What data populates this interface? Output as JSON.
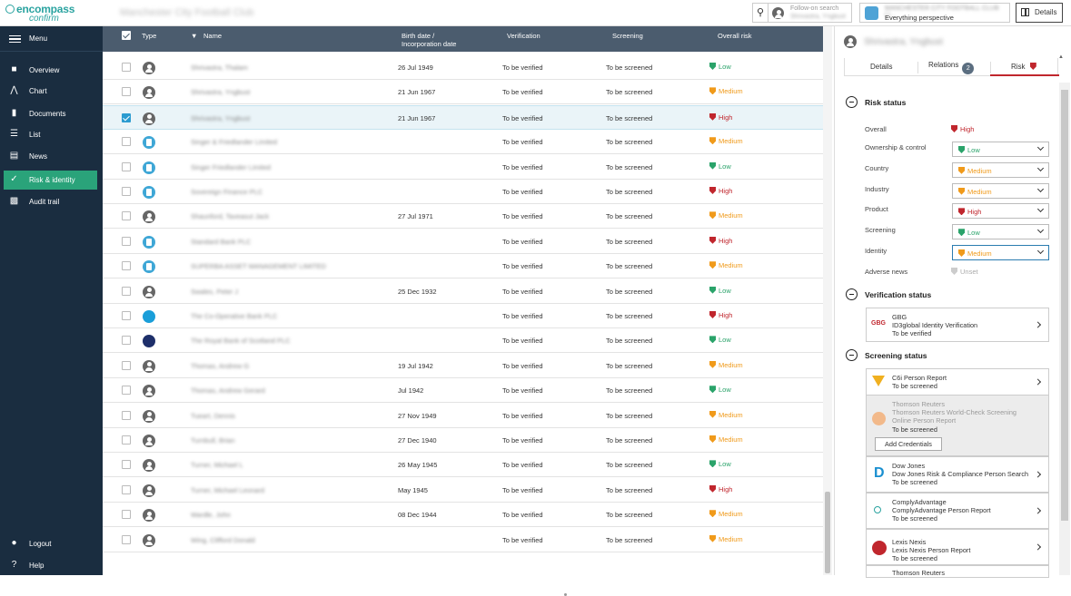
{
  "header": {
    "logo_line1": "encompass",
    "logo_line2": "confirm",
    "case_title": "Manchester City Football Club",
    "follow_label": "Follow-on search",
    "follow_name": "Shrivastra, Yngbust",
    "perspective_name": "MANCHESTER CITY FOOTBALL CLUB LI...",
    "perspective_sub": "Everything perspective",
    "details_label": "Details"
  },
  "sidebar": {
    "menu_label": "Menu",
    "items": [
      {
        "label": "Overview",
        "icon": "folder-icon"
      },
      {
        "label": "Chart",
        "icon": "chart-icon"
      },
      {
        "label": "Documents",
        "icon": "documents-icon"
      },
      {
        "label": "List",
        "icon": "list-icon"
      },
      {
        "label": "News",
        "icon": "news-icon"
      },
      {
        "label": "Risk & identity",
        "icon": "risk-check-icon",
        "active": true
      },
      {
        "label": "Audit trail",
        "icon": "audit-icon"
      }
    ],
    "logout_label": "Logout",
    "help_label": "Help"
  },
  "table": {
    "headers": {
      "type": "Type",
      "name": "Name",
      "birth": "Birth date / Incorporation date",
      "verification": "Verification",
      "screening": "Screening",
      "risk": "Overall risk"
    },
    "rows": [
      {
        "type": "person",
        "name": "Shrivastra, Thalam",
        "birth": "26 Jul 1949",
        "verification": "To be verified",
        "screening": "To be screened",
        "risk": "Low",
        "level": "low"
      },
      {
        "type": "person",
        "name": "Shrivastra, Yngbust",
        "birth": "21 Jun 1967",
        "verification": "To be verified",
        "screening": "To be screened",
        "risk": "Medium",
        "level": "medium"
      },
      {
        "type": "person",
        "name": "Shrivastra, Yngbust",
        "birth": "21 Jun 1967",
        "verification": "To be verified",
        "screening": "To be screened",
        "risk": "High",
        "level": "high",
        "selected": true
      },
      {
        "type": "org",
        "name": "Singer & Friedlander Limited",
        "birth": "",
        "verification": "To be verified",
        "screening": "To be screened",
        "risk": "Medium",
        "level": "medium"
      },
      {
        "type": "org",
        "name": "Singer Friedlander Limited",
        "birth": "",
        "verification": "To be verified",
        "screening": "To be screened",
        "risk": "Low",
        "level": "low"
      },
      {
        "type": "org",
        "name": "Sovereign Finance PLC",
        "birth": "",
        "verification": "To be verified",
        "screening": "To be screened",
        "risk": "High",
        "level": "high"
      },
      {
        "type": "person",
        "name": "Shaunford, Taveasut Jack",
        "birth": "27 Jul 1971",
        "verification": "To be verified",
        "screening": "To be screened",
        "risk": "Medium",
        "level": "medium"
      },
      {
        "type": "org",
        "name": "Standard Bank PLC",
        "birth": "",
        "verification": "To be verified",
        "screening": "To be screened",
        "risk": "High",
        "level": "high"
      },
      {
        "type": "org",
        "name": "SUPERBA ASSET MANAGEMENT LIMITED",
        "birth": "",
        "verification": "To be verified",
        "screening": "To be screened",
        "risk": "Medium",
        "level": "medium"
      },
      {
        "type": "person",
        "name": "Swales, Peter J",
        "birth": "25 Dec 1932",
        "verification": "To be verified",
        "screening": "To be screened",
        "risk": "Low",
        "level": "low"
      },
      {
        "type": "logo1",
        "name": "The Co-Operative Bank PLC",
        "birth": "",
        "verification": "To be verified",
        "screening": "To be screened",
        "risk": "High",
        "level": "high"
      },
      {
        "type": "logo2",
        "name": "The Royal Bank of Scotland PLC",
        "birth": "",
        "verification": "To be verified",
        "screening": "To be screened",
        "risk": "Low",
        "level": "low"
      },
      {
        "type": "person",
        "name": "Thomas, Andrew G",
        "birth": "19 Jul 1942",
        "verification": "To be verified",
        "screening": "To be screened",
        "risk": "Medium",
        "level": "medium"
      },
      {
        "type": "person",
        "name": "Thomas, Andrew Gerard",
        "birth": "Jul 1942",
        "verification": "To be verified",
        "screening": "To be screened",
        "risk": "Low",
        "level": "low"
      },
      {
        "type": "person",
        "name": "Tueart, Dennis",
        "birth": "27 Nov 1949",
        "verification": "To be verified",
        "screening": "To be screened",
        "risk": "Medium",
        "level": "medium"
      },
      {
        "type": "person",
        "name": "Turnbull, Brian",
        "birth": "27 Dec 1940",
        "verification": "To be verified",
        "screening": "To be screened",
        "risk": "Medium",
        "level": "medium"
      },
      {
        "type": "person",
        "name": "Turner, Michael L",
        "birth": "26 May 1945",
        "verification": "To be verified",
        "screening": "To be screened",
        "risk": "Low",
        "level": "low"
      },
      {
        "type": "person",
        "name": "Turner, Michael Leonard",
        "birth": "May 1945",
        "verification": "To be verified",
        "screening": "To be screened",
        "risk": "High",
        "level": "high"
      },
      {
        "type": "person",
        "name": "Wardle, John",
        "birth": "08 Dec 1944",
        "verification": "To be verified",
        "screening": "To be screened",
        "risk": "Medium",
        "level": "medium"
      },
      {
        "type": "person",
        "name": "Wing, Clifford Donald",
        "birth": "",
        "verification": "To be verified",
        "screening": "To be screened",
        "risk": "Medium",
        "level": "medium"
      }
    ]
  },
  "panel": {
    "subject_name": "Shrivastra, Yngbust",
    "tabs": {
      "details": "Details",
      "relations": "Relations",
      "relations_count": "2",
      "risk": "Risk"
    },
    "risk_status": {
      "title": "Risk status",
      "overall_label": "Overall",
      "overall_value": "High",
      "fields": [
        {
          "label": "Ownership & control",
          "value": "Low",
          "level": "low"
        },
        {
          "label": "Country",
          "value": "Medium",
          "level": "medium"
        },
        {
          "label": "Industry",
          "value": "Medium",
          "level": "medium"
        },
        {
          "label": "Product",
          "value": "High",
          "level": "high"
        },
        {
          "label": "Screening",
          "value": "Low",
          "level": "low"
        },
        {
          "label": "Identity",
          "value": "Medium",
          "level": "medium"
        }
      ],
      "adverse_label": "Adverse news",
      "adverse_value": "Unset"
    },
    "verification_status": {
      "title": "Verification status",
      "provider": "GBG",
      "logo_text": "GBG",
      "product": "ID3global Identity Verification",
      "status": "To be verified"
    },
    "screening_status": {
      "title": "Screening status",
      "providers": [
        {
          "l1": "C6i Person Report",
          "l2": "To be screened",
          "icon": "c6-icon"
        },
        {
          "l1": "Thomson Reuters",
          "l2": "Thomson Reuters World-Check Screening",
          "l3": "Online Person Report",
          "l4": "To be screened",
          "icon": "thomson-reuters-icon"
        },
        {
          "l1": "Dow Jones",
          "l2": "Dow Jones Risk & Compliance Person Search",
          "l3": "To be screened",
          "icon": "dow-jones-icon"
        },
        {
          "l1": "ComplyAdvantage",
          "l2": "ComplyAdvantage Person Report",
          "l3": "To be screened",
          "icon": "comply-advantage-icon"
        },
        {
          "l1": "Lexis Nexis",
          "l2": "Lexis Nexis Person Report",
          "l3": "To be screened",
          "icon": "lexis-nexis-icon"
        },
        {
          "l1": "Thomson Reuters",
          "icon": "thomson-reuters-icon"
        }
      ],
      "add_credentials_label": "Add Credentials"
    }
  },
  "colors": {
    "low": "#2aa36a",
    "medium": "#f09a1a",
    "high": "#c0262d",
    "sidebar": "#1a2d40",
    "active": "#2aa37a",
    "table_header": "#4b5c6e"
  }
}
